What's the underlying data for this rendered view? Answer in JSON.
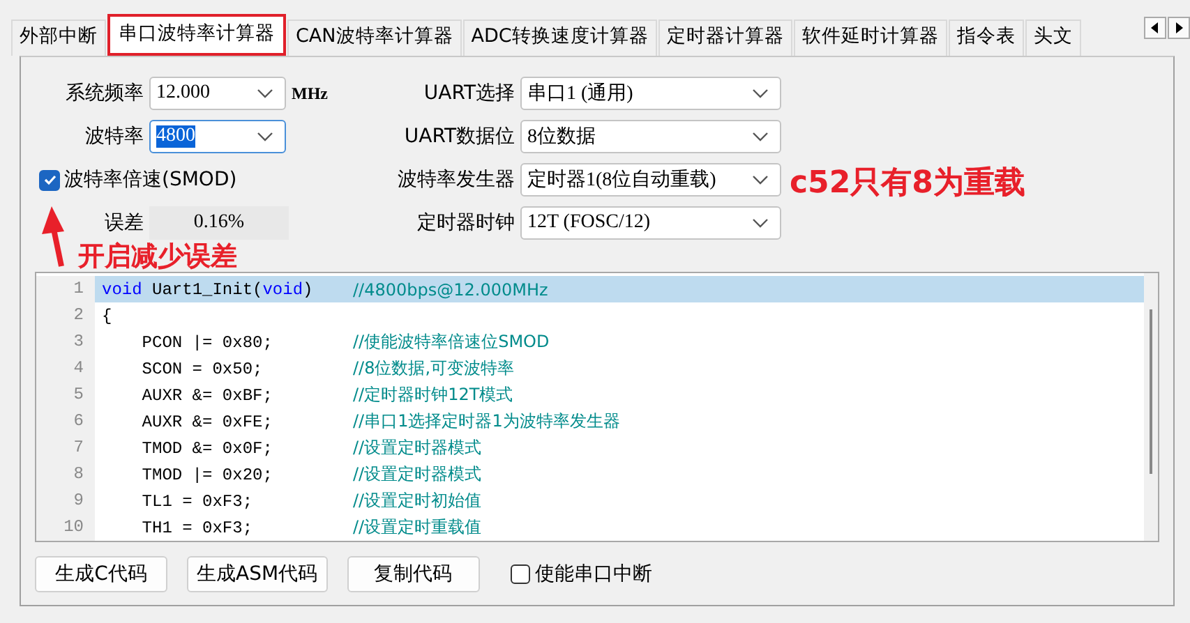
{
  "tabs": [
    {
      "label": "外部中断",
      "selected": false
    },
    {
      "label": "串口波特率计算器",
      "selected": true
    },
    {
      "label": "CAN波特率计算器",
      "selected": false
    },
    {
      "label": "ADC转换速度计算器",
      "selected": false
    },
    {
      "label": "定时器计算器",
      "selected": false
    },
    {
      "label": "软件延时计算器",
      "selected": false
    },
    {
      "label": "指令表",
      "selected": false
    },
    {
      "label": "头文",
      "selected": false
    }
  ],
  "left_fields": [
    {
      "label": "系统频率",
      "value": "12.000",
      "unit": "MHz",
      "focused": false
    },
    {
      "label": "波特率",
      "value": "4800",
      "focused": true
    }
  ],
  "smod_checkbox": {
    "label": "波特率倍速(SMOD)",
    "checked": true
  },
  "error": {
    "label": "误差",
    "value": "0.16%"
  },
  "right_fields": [
    {
      "label": "UART选择",
      "value": "串口1 (通用)"
    },
    {
      "label": "UART数据位",
      "value": "8位数据"
    },
    {
      "label": "波特率发生器",
      "value": "定时器1(8位自动重载)"
    },
    {
      "label": "定时器时钟",
      "value": "12T (FOSC/12)"
    }
  ],
  "code_lines": [
    {
      "number": "1",
      "highlighted": true,
      "segments": [
        {
          "text": "void",
          "kind": "keyword"
        },
        {
          "text": " Uart1_Init(",
          "kind": "plain"
        },
        {
          "text": "void",
          "kind": "keyword"
        },
        {
          "text": ")",
          "kind": "plain"
        }
      ],
      "comment": "//4800bps@12.000MHz"
    },
    {
      "number": "2",
      "highlighted": false,
      "segments": [
        {
          "text": "{",
          "kind": "plain"
        }
      ]
    },
    {
      "number": "3",
      "highlighted": false,
      "segments": [
        {
          "text": "    PCON |= 0x80;",
          "kind": "plain"
        }
      ],
      "comment": "//使能波特率倍速位SMOD"
    },
    {
      "number": "4",
      "highlighted": false,
      "segments": [
        {
          "text": "    SCON = 0x50;",
          "kind": "plain"
        }
      ],
      "comment": "//8位数据,可变波特率"
    },
    {
      "number": "5",
      "highlighted": false,
      "segments": [
        {
          "text": "    AUXR &= 0xBF;",
          "kind": "plain"
        }
      ],
      "comment": "//定时器时钟12T模式"
    },
    {
      "number": "6",
      "highlighted": false,
      "segments": [
        {
          "text": "    AUXR &= 0xFE;",
          "kind": "plain"
        }
      ],
      "comment": "//串口1选择定时器1为波特率发生器"
    },
    {
      "number": "7",
      "highlighted": false,
      "segments": [
        {
          "text": "    TMOD &= 0x0F;",
          "kind": "plain"
        }
      ],
      "comment": "//设置定时器模式"
    },
    {
      "number": "8",
      "highlighted": false,
      "segments": [
        {
          "text": "    TMOD |= 0x20;",
          "kind": "plain"
        }
      ],
      "comment": "//设置定时器模式"
    },
    {
      "number": "9",
      "highlighted": false,
      "segments": [
        {
          "text": "    TL1 = 0xF3;",
          "kind": "plain"
        }
      ],
      "comment": "//设置定时初始值"
    },
    {
      "number": "10",
      "highlighted": false,
      "segments": [
        {
          "text": "    TH1 = 0xF3;",
          "kind": "plain"
        }
      ],
      "comment": "//设置定时重载值"
    }
  ],
  "buttons": [
    "生成C代码",
    "生成ASM代码",
    "复制代码"
  ],
  "interrupt_checkbox": {
    "label": "使能串口中断",
    "checked": false
  },
  "annotations": [
    {
      "kind": "arrow-note",
      "text": "开启减少误差"
    },
    {
      "kind": "note",
      "text": "c52只有8为重载"
    }
  ]
}
